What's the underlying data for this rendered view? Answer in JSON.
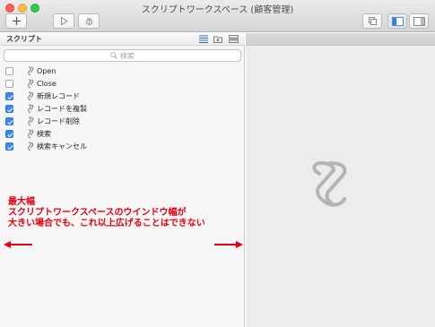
{
  "window": {
    "title": "スクリプトワークスペース (顧客管理)"
  },
  "toolbar": {
    "new_icon": "plus-icon",
    "run_icon": "play-icon",
    "debug_icon": "bug-icon",
    "copy_icon": "duplicate-icon",
    "left_panel_icon": "sidebar-left-icon",
    "right_panel_icon": "sidebar-right-icon"
  },
  "sidebar": {
    "title": "スクリプト",
    "search_placeholder": "検索",
    "items": [
      {
        "label": "Open",
        "checked": false
      },
      {
        "label": "Close",
        "checked": false
      },
      {
        "label": "新規レコード",
        "checked": true
      },
      {
        "label": "レコードを複製",
        "checked": true
      },
      {
        "label": "レコード削除",
        "checked": true
      },
      {
        "label": "検索",
        "checked": true
      },
      {
        "label": "検索キャンセル",
        "checked": true
      }
    ]
  },
  "annotation": {
    "line1": "最大幅",
    "line2": "スクリプトワークスペースのウインドウ幅が",
    "line3": "大きい場合でも、これ以上広げることはできない",
    "color": "#e60012"
  },
  "colors": {
    "checkbox_on": "#3b8af0",
    "right_pane": "#ececec",
    "placeholder_icon": "#b4b4b4"
  }
}
